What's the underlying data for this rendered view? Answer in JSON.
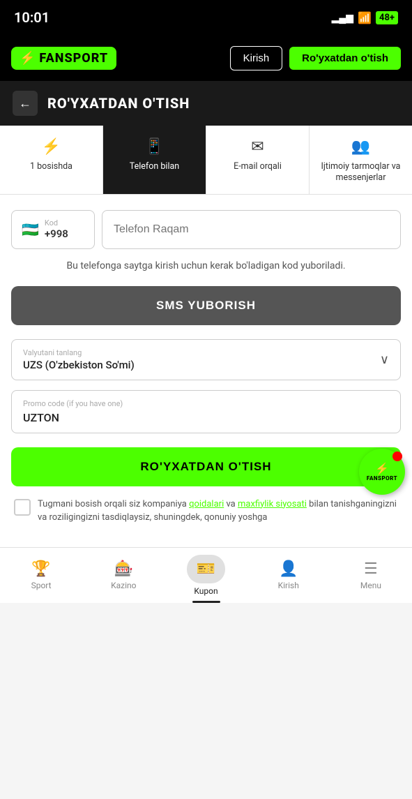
{
  "statusBar": {
    "time": "10:01",
    "battery": "48+"
  },
  "topNav": {
    "logoText": "FANSPORT",
    "kirishLabel": "Kirish",
    "royxatLabel": "Ro'yxatdan o'tish"
  },
  "pageHeader": {
    "backLabel": "←",
    "title": "RO'YXATDAN O'TISH"
  },
  "tabs": [
    {
      "id": "flash",
      "icon": "⚡",
      "label": "1 bosishda",
      "active": false
    },
    {
      "id": "phone",
      "icon": "📱",
      "label": "Telefon bilan",
      "active": true
    },
    {
      "id": "email",
      "icon": "✉",
      "label": "E-mail orqali",
      "active": false
    },
    {
      "id": "social",
      "icon": "👥",
      "label": "Ijtimoiy tarmoqlar va messenjerlar",
      "active": false
    }
  ],
  "form": {
    "countryCodeLabel": "Kod",
    "countryCode": "+998",
    "flag": "🇺🇿",
    "phonePlaceholder": "Telefon Raqam",
    "hintText": "Bu telefonga saytga kirish uchun kerak bo'ladigan kod yuboriladi.",
    "smsButtonLabel": "SMS YUBORISH",
    "currencyLabel": "Valyutani tanlang",
    "currencyValue": "UZS  (O'zbekiston So'mi)",
    "promoLabel": "Promo code (if you have one)",
    "promoValue": "UZTON",
    "registerButtonLabel": "RO'YXATDAN O'TISH",
    "termsText": "Tugmani bosish orqali siz kompaniya qoidalari va maxfiylik siyosati bilan tanishganingizni va roziligingizni tasdiqlaysiz, shuningdek, qonuniy yoshga",
    "termsLink1": "qoidalari",
    "termsLink2": "maxfiylik siyosati"
  },
  "floatBadge": {
    "icon": "⚡",
    "text": "FANSPORT"
  },
  "bottomNav": [
    {
      "id": "sport",
      "icon": "🏆",
      "label": "Sport",
      "active": false
    },
    {
      "id": "kazino",
      "icon": "🎰",
      "label": "Kazino",
      "active": false
    },
    {
      "id": "kupon",
      "icon": "🎫",
      "label": "Kupon",
      "active": true
    },
    {
      "id": "kirish",
      "icon": "👤",
      "label": "Kirish",
      "active": false
    },
    {
      "id": "menu",
      "icon": "☰",
      "label": "Menu",
      "active": false
    }
  ]
}
